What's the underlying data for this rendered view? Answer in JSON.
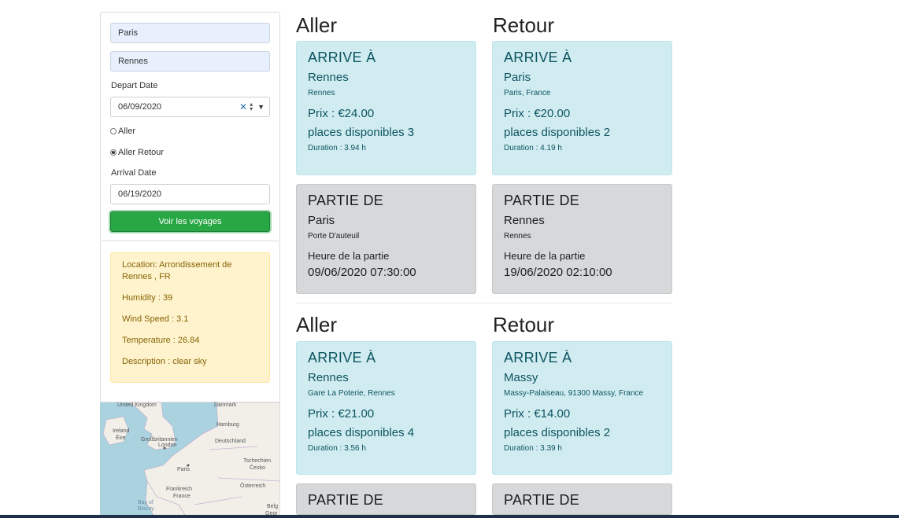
{
  "search": {
    "from": "Paris",
    "to": "Rennes",
    "depart_label": "Depart Date",
    "depart_date": "06/09/2020",
    "option_one_way": "Aller",
    "option_round_trip": "Aller Retour",
    "selected_option": "Aller Retour",
    "arrival_label": "Arrival Date",
    "arrival_date": "06/19/2020",
    "submit_label": "Voir les voyages"
  },
  "weather": {
    "location": "Location: Arrondissement de Rennes , FR",
    "humidity": "Humidity : 39",
    "wind": "Wind Speed : 3.1",
    "temperature": "Temperature : 26.84",
    "description": "Description : clear sky"
  },
  "map": {
    "labels": [
      "United Kingdom",
      "Danmark",
      "Ireland",
      "Éire",
      "Großbritannien",
      "London",
      "Hamburg",
      "Deutschland",
      "Paris",
      "Tschechien",
      "Česko",
      "Frankreich",
      "France",
      "Österreich",
      "Bay of Biscay",
      "Belg",
      "Geor"
    ]
  },
  "trips": [
    {
      "outbound_title": "Aller",
      "return_title": "Retour",
      "outbound": {
        "arrive_heading": "ARRIVE À",
        "arrive_city": "Rennes",
        "arrive_place": "Rennes",
        "price": "Prix : €24.00",
        "seats": "places disponibles 3",
        "duration": "Duration : 3.94 h",
        "depart_heading": "PARTIE DE",
        "depart_city": "Paris",
        "depart_place": "Porte D'auteuil",
        "depart_time_label": "Heure de la partie",
        "depart_time": "09/06/2020 07:30:00"
      },
      "return": {
        "arrive_heading": "ARRIVE À",
        "arrive_city": "Paris",
        "arrive_place": "Paris, France",
        "price": "Prix : €20.00",
        "seats": "places disponibles 2",
        "duration": "Duration : 4.19 h",
        "depart_heading": "PARTIE DE",
        "depart_city": "Rennes",
        "depart_place": "Rennes",
        "depart_time_label": "Heure de la partie",
        "depart_time": "19/06/2020 02:10:00"
      }
    },
    {
      "outbound_title": "Aller",
      "return_title": "Retour",
      "outbound": {
        "arrive_heading": "ARRIVE À",
        "arrive_city": "Rennes",
        "arrive_place": "Gare La Poterie, Rennes",
        "price": "Prix : €21.00",
        "seats": "places disponibles 4",
        "duration": "Duration : 3.56 h",
        "depart_heading": "PARTIE DE"
      },
      "return": {
        "arrive_heading": "ARRIVE À",
        "arrive_city": "Massy",
        "arrive_place": "Massy-Palaiseau, 91300 Massy, France",
        "price": "Prix : €14.00",
        "seats": "places disponibles 2",
        "duration": "Duration : 3.39 h",
        "depart_heading": "PARTIE DE"
      }
    }
  ],
  "colors": {
    "arrive_bg": "#d1ecf1",
    "depart_bg": "#d6d8d9",
    "weather_bg": "#fff3cd",
    "button_bg": "#28a745"
  }
}
